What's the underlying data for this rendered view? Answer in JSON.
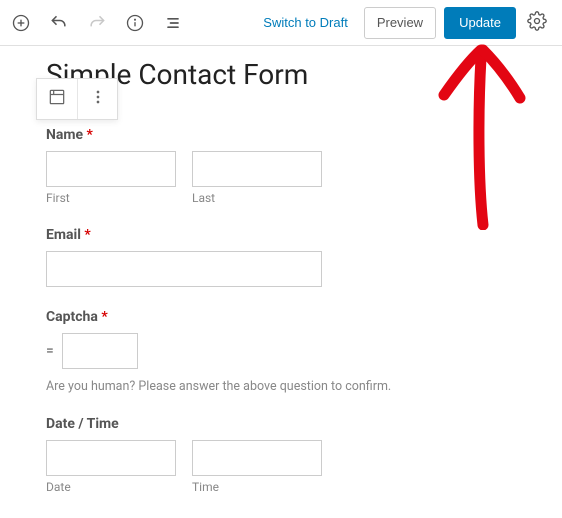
{
  "toolbar": {
    "switch_to_draft": "Switch to Draft",
    "preview": "Preview",
    "update": "Update"
  },
  "page": {
    "title": "Simple Contact Form"
  },
  "form": {
    "name": {
      "label": "Name",
      "required_mark": "*",
      "first_sub": "First",
      "last_sub": "Last"
    },
    "email": {
      "label": "Email",
      "required_mark": "*"
    },
    "captcha": {
      "label": "Captcha",
      "required_mark": "*",
      "equals": "=",
      "hint": "Are you human? Please answer the above question to confirm."
    },
    "datetime": {
      "label": "Date / Time",
      "date_sub": "Date",
      "time_sub": "Time"
    }
  }
}
